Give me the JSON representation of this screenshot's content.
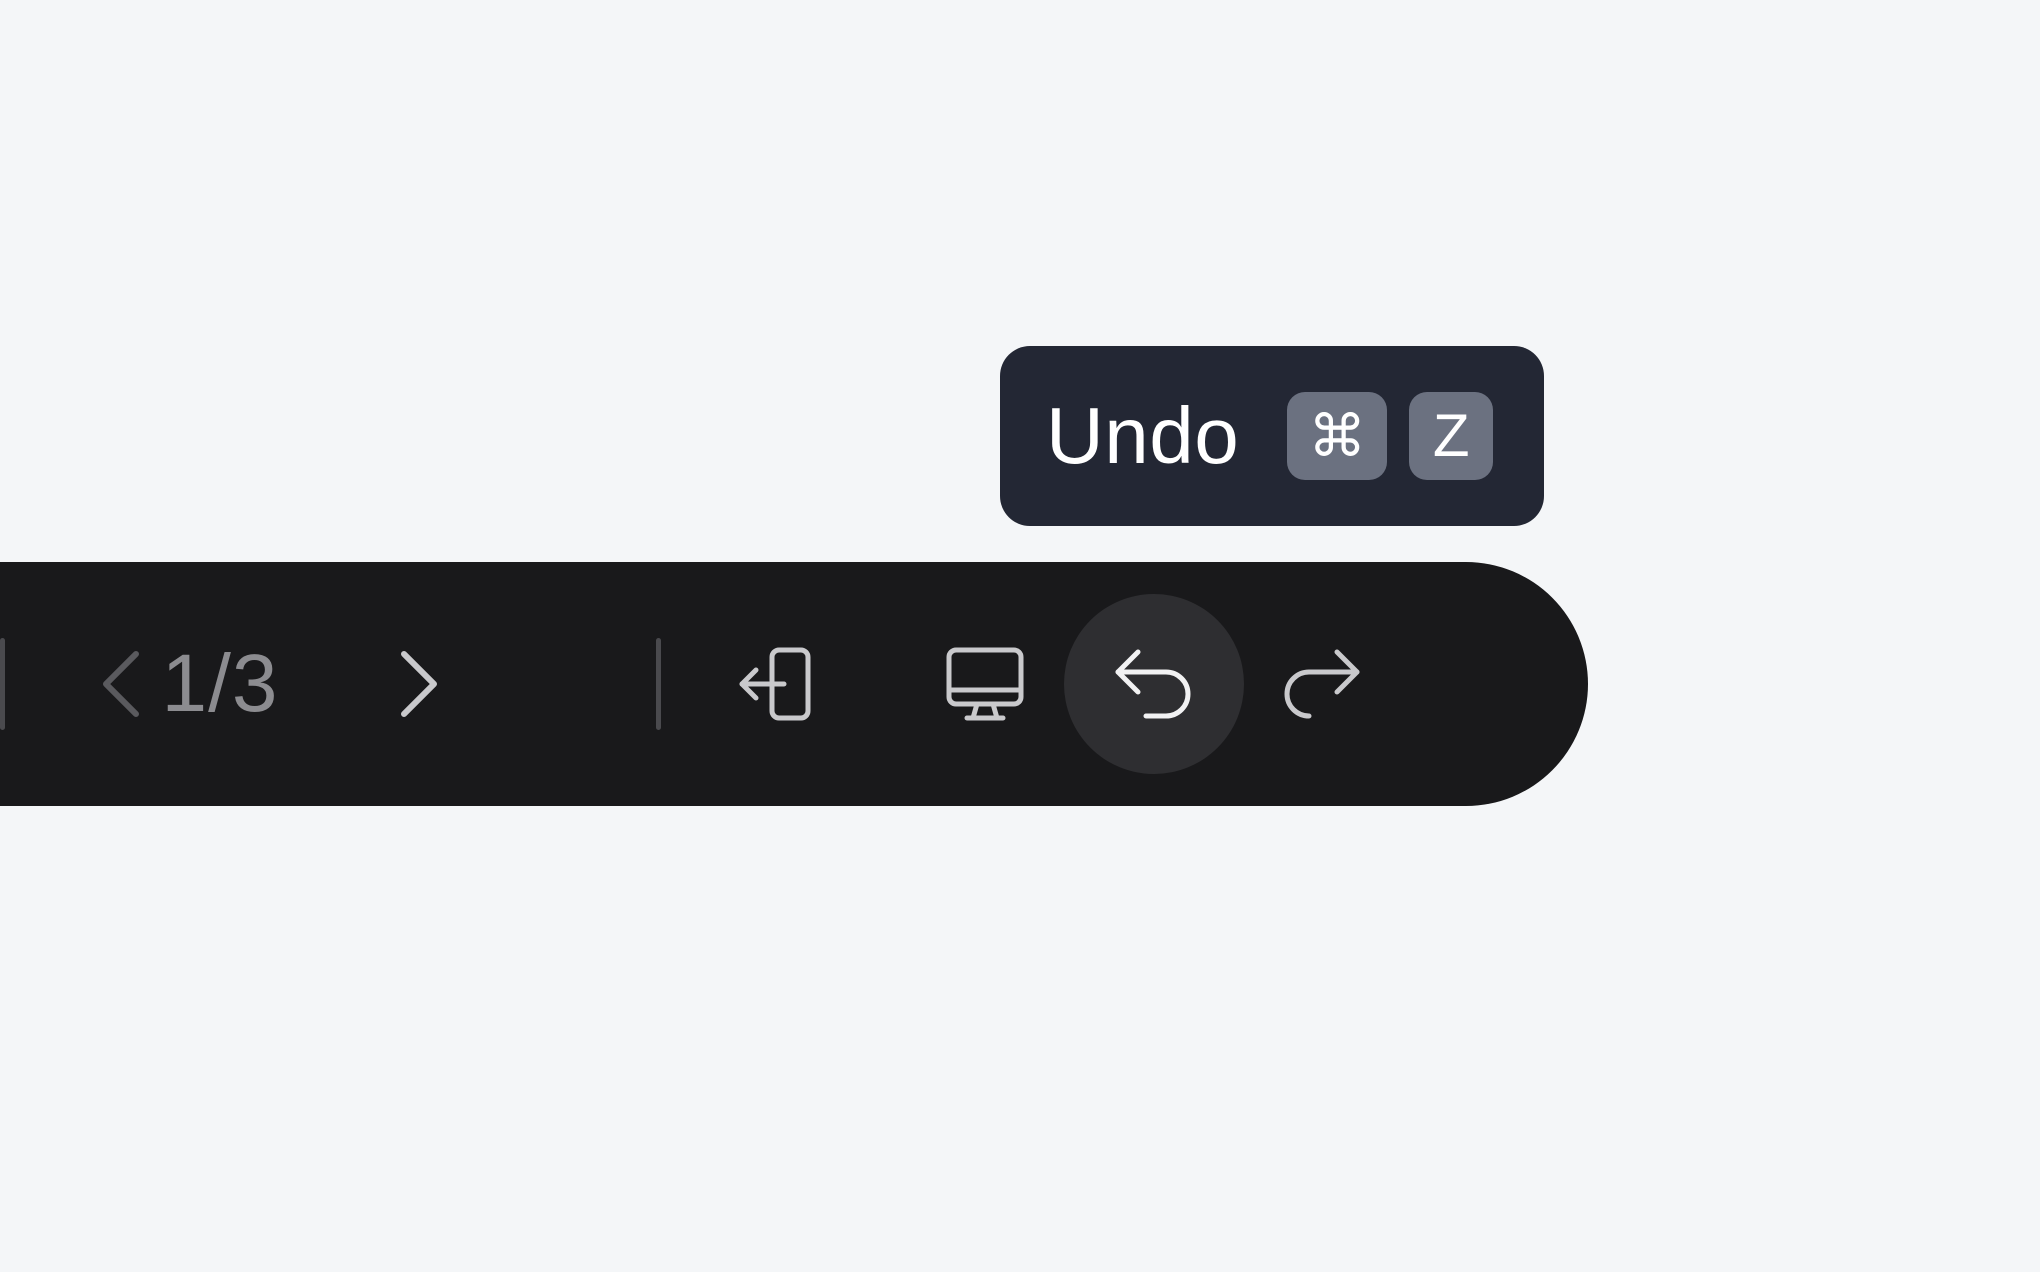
{
  "tooltip": {
    "label": "Undo",
    "shortcut_modifier": "⌘",
    "shortcut_key": "Z"
  },
  "toolbar": {
    "page_indicator": "1/3",
    "icons": {
      "prev": "chevron-left-icon",
      "next": "chevron-right-icon",
      "exit": "exit-presentation-icon",
      "present": "monitor-icon",
      "undo": "undo-icon",
      "redo": "redo-icon"
    }
  },
  "colors": {
    "background": "#f4f6f8",
    "toolbar": "#19191b",
    "tooltip": "#232734",
    "kbd": "#6b7180",
    "active_button": "#2e2e31"
  }
}
